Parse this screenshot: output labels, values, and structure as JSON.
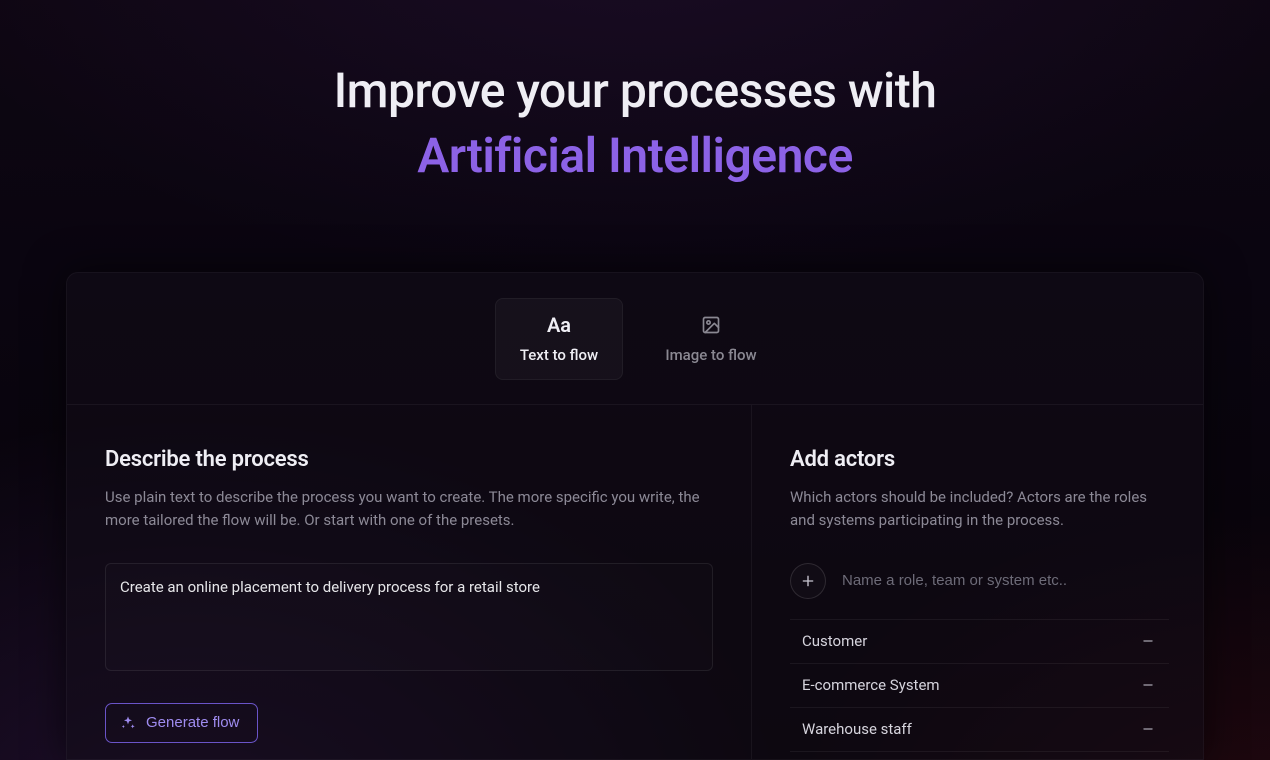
{
  "headline": {
    "line1": "Improve your processes with",
    "line2": "Artificial Intelligence"
  },
  "tabs": {
    "textToFlow": {
      "icon": "Aa",
      "label": "Text to flow"
    },
    "imageToFlow": {
      "label": "Image to flow"
    }
  },
  "describe": {
    "title": "Describe the process",
    "desc": "Use plain text to describe the process you want to create. The more specific you write, the more tailored the flow will be. Or start with one of the presets.",
    "value": "Create an online placement to delivery process for a retail store",
    "generateLabel": "Generate flow"
  },
  "actors": {
    "title": "Add actors",
    "desc": "Which actors should be included? Actors are the roles and systems participating in the process.",
    "inputPlaceholder": "Name a role, team or system etc..",
    "items": [
      {
        "name": "Customer"
      },
      {
        "name": "E-commerce System"
      },
      {
        "name": "Warehouse staff"
      }
    ]
  }
}
